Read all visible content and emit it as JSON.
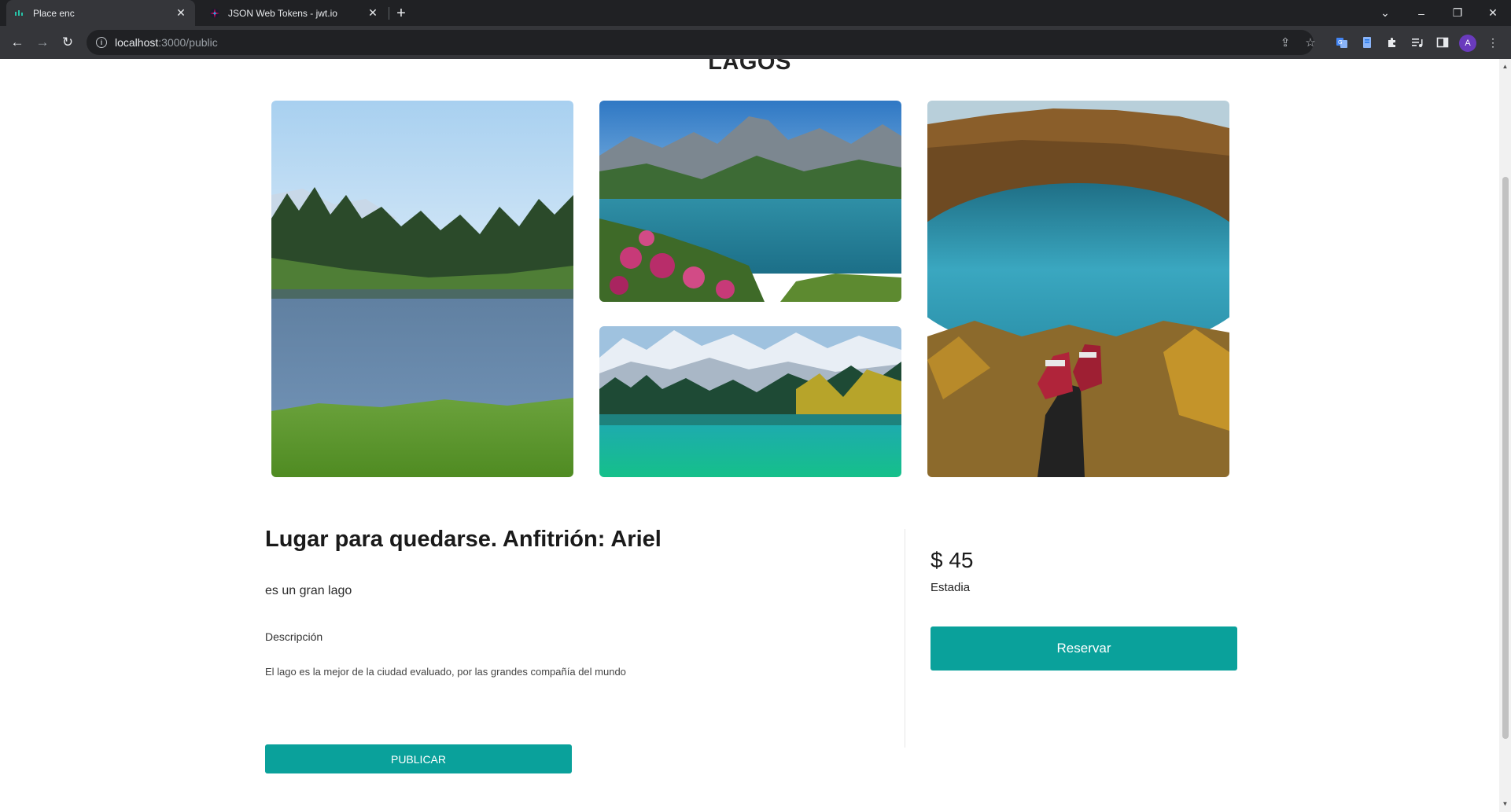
{
  "browser": {
    "tabs": [
      {
        "title": "Place enc",
        "active": true
      },
      {
        "title": "JSON Web Tokens - jwt.io",
        "active": false
      }
    ],
    "address": {
      "host": "localhost",
      "path": ":3000/public"
    },
    "profile_initial": "A"
  },
  "page": {
    "title": "LAGOS",
    "gallery": [
      {
        "alt": "Lago con bosque de pinos y pradera"
      },
      {
        "alt": "Lago alpino con flores rosadas"
      },
      {
        "alt": "Lago turquesa con montañas nevadas"
      },
      {
        "alt": "Lago visto desde una colina con zapatillas"
      }
    ],
    "listing": {
      "host_title": "Lugar para quedarse. Anfitrión: Ariel",
      "subtitle": "es un gran lago",
      "description_label": "Descripción",
      "description": "El lago es la mejor de la ciudad evaluado, por las grandes compañía del mundo",
      "publish_label": "PUBLICAR"
    },
    "booking": {
      "price": "$ 45",
      "price_label": "Estadia",
      "reserve_label": "Reservar"
    }
  },
  "colors": {
    "accent": "#0aa19b",
    "chrome_dark": "#202124",
    "chrome_toolbar": "#35363a"
  }
}
